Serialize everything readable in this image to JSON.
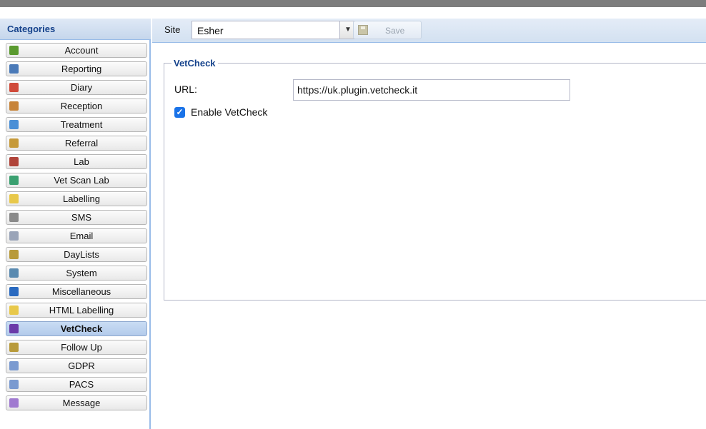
{
  "sidebar": {
    "header": "Categories",
    "items": [
      {
        "label": "Account",
        "icon": "account-icon",
        "color": "#5a9a2f",
        "active": false
      },
      {
        "label": "Reporting",
        "icon": "reporting-icon",
        "color": "#4a7ab8",
        "active": false
      },
      {
        "label": "Diary",
        "icon": "calendar-icon",
        "color": "#d04a3a",
        "active": false
      },
      {
        "label": "Reception",
        "icon": "reception-icon",
        "color": "#c7843a",
        "active": false
      },
      {
        "label": "Treatment",
        "icon": "treatment-icon",
        "color": "#4a8fd6",
        "active": false
      },
      {
        "label": "Referral",
        "icon": "referral-icon",
        "color": "#c69a3a",
        "active": false
      },
      {
        "label": "Lab",
        "icon": "lab-icon",
        "color": "#b0443a",
        "active": false
      },
      {
        "label": "Vet Scan Lab",
        "icon": "vet-scan-icon",
        "color": "#3aa070",
        "active": false
      },
      {
        "label": "Labelling",
        "icon": "label-icon",
        "color": "#e8c84a",
        "active": false
      },
      {
        "label": "SMS",
        "icon": "phone-icon",
        "color": "#8a8a8a",
        "active": false
      },
      {
        "label": "Email",
        "icon": "envelope-icon",
        "color": "#9aa4b8",
        "active": false
      },
      {
        "label": "DayLists",
        "icon": "list-icon",
        "color": "#b89a3a",
        "active": false
      },
      {
        "label": "System",
        "icon": "system-icon",
        "color": "#5a8ab0",
        "active": false
      },
      {
        "label": "Miscellaneous",
        "icon": "info-icon",
        "color": "#2a6ac0",
        "active": false
      },
      {
        "label": "HTML Labelling",
        "icon": "html-label-icon",
        "color": "#e8c84a",
        "active": false
      },
      {
        "label": "VetCheck",
        "icon": "vetcheck-icon",
        "color": "#6a3aa8",
        "active": true
      },
      {
        "label": "Follow Up",
        "icon": "followup-list-icon",
        "color": "#b89a3a",
        "active": false
      },
      {
        "label": "GDPR",
        "icon": "gdpr-icon",
        "color": "#7a9ad0",
        "active": false
      },
      {
        "label": "PACS",
        "icon": "pacs-icon",
        "color": "#7a9ad0",
        "active": false
      },
      {
        "label": "Message",
        "icon": "message-icon",
        "color": "#a07ad0",
        "active": false
      }
    ]
  },
  "toolbar": {
    "site_label": "Site",
    "site_value": "Esher",
    "save_label": "Save"
  },
  "form": {
    "legend": "VetCheck",
    "url_label": "URL:",
    "url_value": "https://uk.plugin.vetcheck.it",
    "enable_label": "Enable VetCheck",
    "enable_checked": true
  },
  "colors": {
    "accent": "#15428b",
    "sidebar_border": "#99bce8",
    "checkbox": "#1a73e8"
  }
}
